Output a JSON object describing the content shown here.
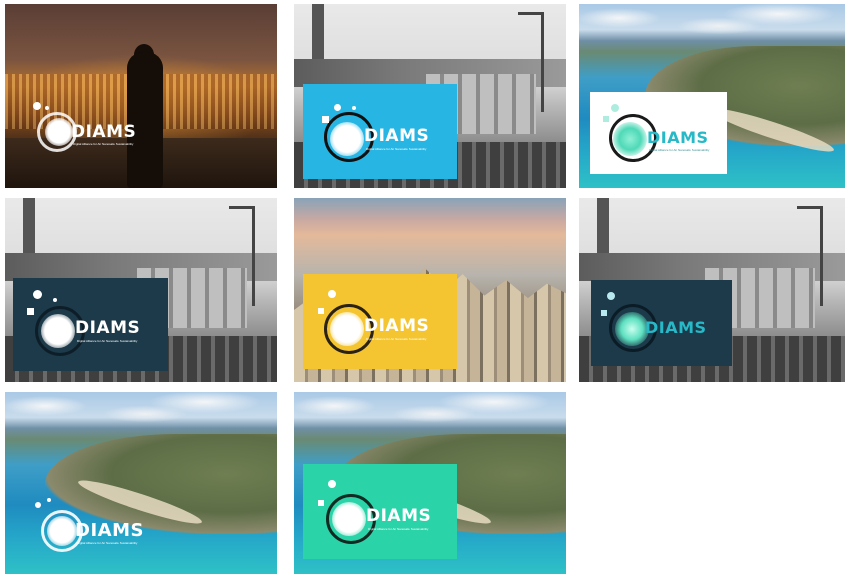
{
  "brand": {
    "wordmark": "DIAMS",
    "tagline": "Digital Alliance for Air Nanosafe Sustainability"
  },
  "tiles": [
    {
      "photo": "sunset-city-silhouette",
      "panel": "none",
      "panel_color": ""
    },
    {
      "photo": "grayscale-rooftop",
      "panel": "solid",
      "panel_color": "#27b5e3"
    },
    {
      "photo": "aerial-coast",
      "panel": "solid",
      "panel_color": "#ffffff"
    },
    {
      "photo": "grayscale-rooftop",
      "panel": "solid",
      "panel_color": "#1c3a4a"
    },
    {
      "photo": "city-skyline",
      "panel": "solid",
      "panel_color": "#f4c531"
    },
    {
      "photo": "grayscale-rooftop",
      "panel": "solid",
      "panel_color": "#1c3a4a"
    },
    {
      "photo": "aerial-coast",
      "panel": "none",
      "panel_color": ""
    },
    {
      "photo": "aerial-coast",
      "panel": "solid",
      "panel_color": "#2bd3a8"
    }
  ]
}
